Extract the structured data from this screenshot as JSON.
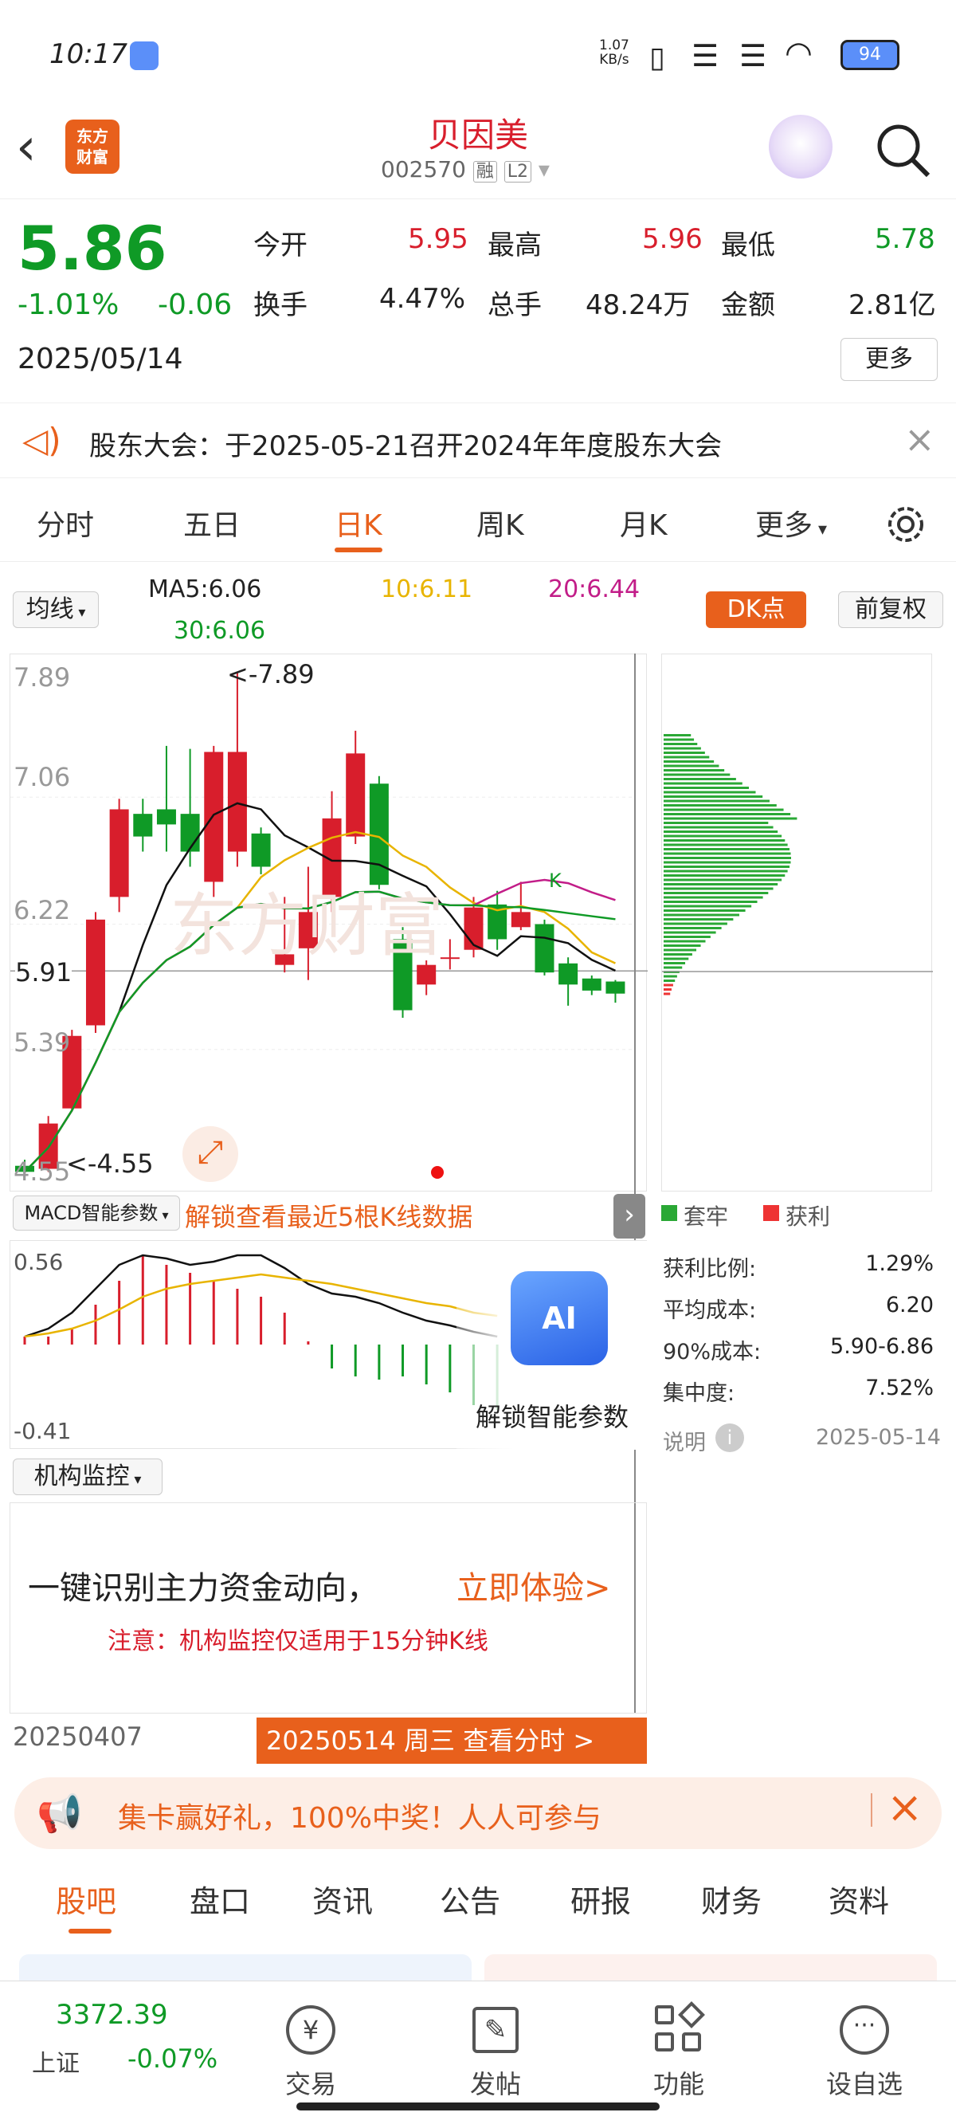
{
  "status": {
    "time": "10:17",
    "net_speed_top": "1.07",
    "net_speed_bottom": "KB/s",
    "battery": "94"
  },
  "header": {
    "logo": "东方\n财富",
    "name": "贝因美",
    "code": "002570",
    "tag_rong": "融",
    "tag_l2": "L2"
  },
  "quote": {
    "price": "5.86",
    "change_pct": "-1.01%",
    "change": "-0.06",
    "date": "2025/05/14",
    "open_label": "今开",
    "open": "5.95",
    "high_label": "最高",
    "high": "5.96",
    "low_label": "最低",
    "low": "5.78",
    "turnover_label": "换手",
    "turnover": "4.47%",
    "volume_label": "总手",
    "volume": "48.24万",
    "amount_label": "金额",
    "amount": "2.81亿",
    "more_btn": "更多"
  },
  "notice": {
    "text": "股东大会：于2025-05-21召开2024年年度股东大会"
  },
  "chart_tabs": [
    "分时",
    "五日",
    "日K",
    "周K",
    "月K",
    "更多"
  ],
  "kline_legend": {
    "type_btn": "均线",
    "ma5": "MA5:6.06",
    "ma10": "10:6.11",
    "ma20": "20:6.44",
    "ma30": "30:6.06",
    "dk_btn": "DK点",
    "fq_btn": "前复权"
  },
  "kline_axis": {
    "y_labels": [
      "7.89",
      "7.06",
      "6.22",
      "5.39",
      "4.55"
    ],
    "high_mark": "<-7.89",
    "low_mark": "<-4.55",
    "current": "5.91",
    "dk_marker": "K"
  },
  "macd": {
    "label": "MACD智能参数",
    "unlock_text": "解锁查看最近5根K线数据",
    "top": "0.56",
    "bottom": "-0.41",
    "ai_label": "AI",
    "ai_unlock": "解锁智能参数"
  },
  "chip": {
    "trapped": "套牢",
    "profit": "获利",
    "rows": [
      {
        "k": "获利比例:",
        "v": "1.29%"
      },
      {
        "k": "平均成本:",
        "v": "6.20"
      },
      {
        "k": "90%成本:",
        "v": "5.90-6.86"
      },
      {
        "k": "集中度:",
        "v": "7.52%"
      }
    ],
    "note": "说明",
    "date": "2025-05-14"
  },
  "inst": {
    "label": "机构监控",
    "title": "一键识别主力资金动向，",
    "cta": "立即体验>",
    "note": "注意：机构监控仅适用于15分钟K线"
  },
  "dates": {
    "start": "20250407",
    "end": "20250514 周三 查看分时 >"
  },
  "banner": {
    "text": "集卡赢好礼，100%中奖！人人可参与"
  },
  "page_tabs": [
    "股吧",
    "盘口",
    "资讯",
    "公告",
    "研报",
    "财务",
    "资料"
  ],
  "dock": {
    "index_value": "3372.39",
    "index_name": "上证",
    "index_change": "-0.07%",
    "items": [
      "交易",
      "发帖",
      "功能",
      "设自选"
    ]
  },
  "chart_data": {
    "type": "candlestick",
    "y_range": [
      4.55,
      7.89
    ],
    "candles": [
      {
        "o": 4.62,
        "c": 4.58,
        "h": 4.66,
        "l": 4.55
      },
      {
        "o": 4.6,
        "c": 4.9,
        "h": 4.95,
        "l": 4.58
      },
      {
        "o": 5.0,
        "c": 5.48,
        "h": 5.52,
        "l": 4.98
      },
      {
        "o": 5.55,
        "c": 6.25,
        "h": 6.3,
        "l": 5.5
      },
      {
        "o": 6.4,
        "c": 6.98,
        "h": 7.05,
        "l": 6.3
      },
      {
        "o": 6.95,
        "c": 6.8,
        "h": 7.05,
        "l": 6.7
      },
      {
        "o": 6.98,
        "c": 6.88,
        "h": 7.4,
        "l": 6.7
      },
      {
        "o": 6.95,
        "c": 6.7,
        "h": 7.38,
        "l": 6.6
      },
      {
        "o": 6.5,
        "c": 7.36,
        "h": 7.4,
        "l": 6.4
      },
      {
        "o": 6.7,
        "c": 7.36,
        "h": 7.89,
        "l": 6.6
      },
      {
        "o": 6.82,
        "c": 6.6,
        "h": 6.86,
        "l": 6.55
      },
      {
        "o": 5.95,
        "c": 6.02,
        "h": 6.4,
        "l": 5.9
      },
      {
        "o": 6.06,
        "c": 6.3,
        "h": 6.6,
        "l": 5.85
      },
      {
        "o": 6.4,
        "c": 6.92,
        "h": 7.1,
        "l": 6.3
      },
      {
        "o": 6.8,
        "c": 7.35,
        "h": 7.5,
        "l": 6.75
      },
      {
        "o": 7.15,
        "c": 6.48,
        "h": 7.2,
        "l": 6.45
      },
      {
        "o": 6.12,
        "c": 5.65,
        "h": 6.2,
        "l": 5.6
      },
      {
        "o": 5.82,
        "c": 5.95,
        "h": 5.98,
        "l": 5.75
      },
      {
        "o": 6.0,
        "c": 6.0,
        "h": 6.12,
        "l": 5.92
      },
      {
        "o": 6.05,
        "c": 6.33,
        "h": 6.4,
        "l": 6.0
      },
      {
        "o": 6.35,
        "c": 6.12,
        "h": 6.44,
        "l": 6.05
      },
      {
        "o": 6.2,
        "c": 6.3,
        "h": 6.5,
        "l": 6.18
      },
      {
        "o": 6.22,
        "c": 5.9,
        "h": 6.25,
        "l": 5.88
      },
      {
        "o": 5.96,
        "c": 5.82,
        "h": 6.0,
        "l": 5.68
      },
      {
        "o": 5.86,
        "c": 5.78,
        "h": 5.88,
        "l": 5.75
      },
      {
        "o": 5.84,
        "c": 5.76,
        "h": 5.85,
        "l": 5.7
      }
    ]
  }
}
